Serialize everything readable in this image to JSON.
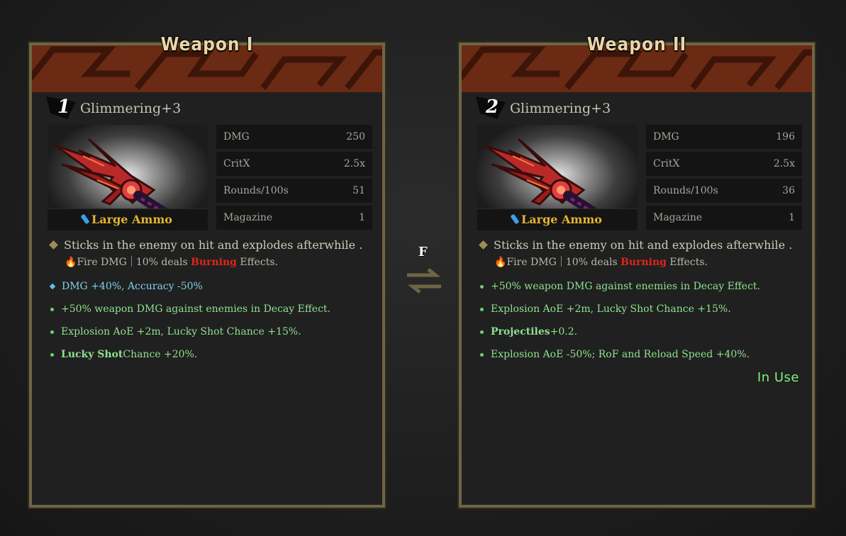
{
  "swap": {
    "key": "F",
    "icon": "swap-arrows-icon"
  },
  "weapons": [
    {
      "title": "Weapon I",
      "slot": "1",
      "name": "Glimmering+3",
      "ammo": "Large Ammo",
      "stats": [
        {
          "label": "DMG",
          "value": "250"
        },
        {
          "label": "CritX",
          "value": "2.5x"
        },
        {
          "label": "Rounds/100s",
          "value": "51"
        },
        {
          "label": "Magazine",
          "value": "1"
        }
      ],
      "description": "Sticks in the enemy on hit and explodes afterwhile .",
      "element": {
        "type": "Fire DMG",
        "chance": "10% deals",
        "effect": "Burning",
        "suffix": "Effects."
      },
      "affixes": [
        {
          "color": "blue",
          "bold": "",
          "text": "DMG +40%, Accuracy -50%"
        },
        {
          "color": "green",
          "bold": "",
          "text": "+50% weapon DMG against enemies in Decay Effect."
        },
        {
          "color": "green",
          "bold": "",
          "text": "Explosion AoE +2m, Lucky Shot Chance +15%."
        },
        {
          "color": "green",
          "bold": "Lucky Shot",
          "text": " Chance +20%."
        }
      ],
      "status": ""
    },
    {
      "title": "Weapon II",
      "slot": "2",
      "name": "Glimmering+3",
      "ammo": "Large Ammo",
      "stats": [
        {
          "label": "DMG",
          "value": "196"
        },
        {
          "label": "CritX",
          "value": "2.5x"
        },
        {
          "label": "Rounds/100s",
          "value": "36"
        },
        {
          "label": "Magazine",
          "value": "1"
        }
      ],
      "description": "Sticks in the enemy on hit and explodes afterwhile .",
      "element": {
        "type": "Fire DMG",
        "chance": "10% deals",
        "effect": "Burning",
        "suffix": "Effects."
      },
      "affixes": [
        {
          "color": "green",
          "bold": "",
          "text": "+50% weapon DMG against enemies in Decay Effect."
        },
        {
          "color": "green",
          "bold": "",
          "text": "Explosion AoE +2m, Lucky Shot Chance +15%."
        },
        {
          "color": "green",
          "bold": "Projectiles",
          "text": " +0.2."
        },
        {
          "color": "green",
          "bold": "",
          "text": "Explosion AoE -50%; RoF and Reload Speed +40%."
        }
      ],
      "status": "In Use"
    }
  ],
  "colors": {
    "frame": "#6f6544",
    "banner": "#6a2a14",
    "ammo": "#e3b431",
    "affix_green": "#8fe08f",
    "affix_blue": "#7fd0e8",
    "burning": "#e0251a",
    "in_use": "#7ef07e"
  }
}
